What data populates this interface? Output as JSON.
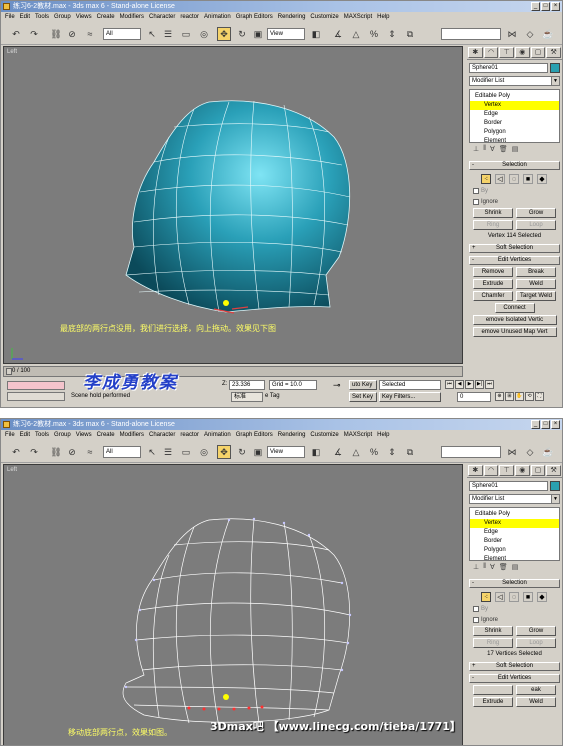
{
  "shot1": {
    "title": "练习6-2教材.max - 3ds max 6 - Stand-alone License",
    "menu": [
      "File",
      "Edit",
      "Tools",
      "Group",
      "Views",
      "Create",
      "Modifiers",
      "Character",
      "reactor",
      "Animation",
      "Graph Editors",
      "Rendering",
      "Customize",
      "MAXScript",
      "Help"
    ],
    "toolbar": {
      "filter": "All",
      "refcoord": "View"
    },
    "viewport_label": "Left",
    "caption": "最底部的两行点没用，我们进行选择，向上拖动。效果见下图",
    "panel": {
      "object_name": "Sphere01",
      "modifier_list": "Modifier List",
      "stack": [
        {
          "label": "Editable Poly",
          "level": 0
        },
        {
          "label": "Vertex",
          "level": 1,
          "selected": true
        },
        {
          "label": "Edge",
          "level": 1
        },
        {
          "label": "Border",
          "level": 1
        },
        {
          "label": "Polygon",
          "level": 1
        },
        {
          "label": "Element",
          "level": 1
        }
      ],
      "selection_title": "Selection",
      "by_label": "By",
      "ignore_label": "Ignore",
      "shrink": "Shrink",
      "grow": "Grow",
      "ring": "Ring",
      "loop": "Loop",
      "status": "Vertex 114 Selected",
      "soft_selection": "Soft Selection",
      "edit_vertices": "Edit Vertices",
      "remove": "Remove",
      "break": "Break",
      "extrude": "Extrude",
      "weld": "Weld",
      "chamfer": "Chamfer",
      "target_weld": "Target Weld",
      "connect": "Connect",
      "remove_isolated": "emove Isolated Vertic",
      "remove_unused": "emove Unused Map Vert"
    },
    "timeline": "0 / 100",
    "status_bar": {
      "coord_label": "Z:",
      "z": "23.336",
      "grid": "Grid = 10.0",
      "auto_key": "uto Key",
      "set_key": "Set Key",
      "selected": "Selected",
      "key_filters": "Key Filters...",
      "frame": "0",
      "prompt": "Scene hold performed",
      "ime": "标准",
      "time_tag": "e Tag"
    },
    "watermark": "李成勇教案"
  },
  "shot2": {
    "title": "练习6-2教材.max - 3ds max 6 - Stand-alone License",
    "viewport_label": "Left",
    "caption": "移动底部两行点，效果如图。",
    "panel": {
      "object_name": "Sphere01",
      "modifier_list": "Modifier List",
      "stack": [
        {
          "label": "Editable Poly",
          "level": 0
        },
        {
          "label": "Vertex",
          "level": 1,
          "selected": true
        },
        {
          "label": "Edge",
          "level": 1
        },
        {
          "label": "Border",
          "level": 1
        },
        {
          "label": "Polygon",
          "level": 1
        },
        {
          "label": "Element",
          "level": 1
        }
      ],
      "selection_title": "Selection",
      "by_label": "By",
      "ignore_label": "Ignore",
      "shrink": "Shrink",
      "grow": "Grow",
      "ring": "Ring",
      "loop": "Loop",
      "status": "17 Vertices Selected",
      "soft_selection": "Soft Selection",
      "edit_vertices": "Edit Vertices",
      "break": "eak",
      "extrude": "Extrude",
      "weld": "Weld"
    }
  },
  "footer": "3Dmax吧 【www.linecg.com/tieba/1771】",
  "colors": {
    "viewport_bg": "#7c7c7c",
    "mesh_fill": "#2aa0b8",
    "selection_yellow": "#ffff00",
    "caption": "#ffff66"
  }
}
